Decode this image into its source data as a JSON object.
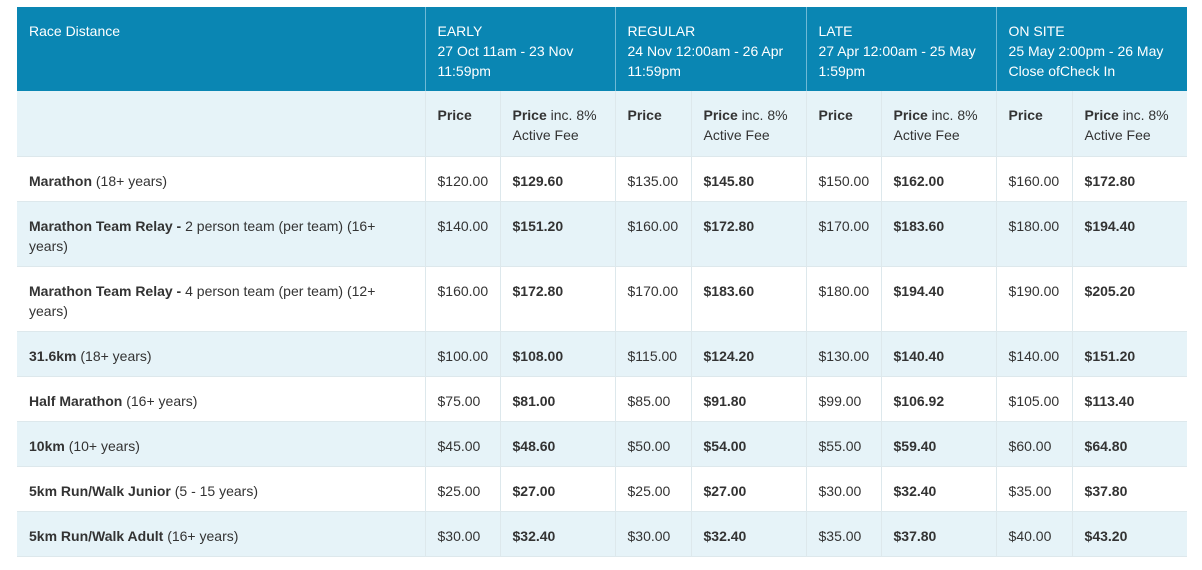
{
  "table": {
    "distance_header": "Race Distance",
    "periods": [
      {
        "name": "EARLY",
        "range": "27 Oct  11am - 23 Nov 11:59pm"
      },
      {
        "name": "REGULAR",
        "range": "24 Nov 12:00am - 26 Apr 11:59pm"
      },
      {
        "name": "LATE",
        "range": "27 Apr 12:00am - 25 May 1:59pm"
      },
      {
        "name": "ON SITE",
        "range": "25 May 2:00pm - 26 May Close ofCheck In"
      }
    ],
    "sub_headers": {
      "price": "Price",
      "price_fee_bold": "Price",
      "price_fee_rest": " inc. 8% Active Fee"
    },
    "rows": [
      {
        "name": "Marathon",
        "detail": " (18+ years)",
        "prices": [
          "$120.00",
          "$129.60",
          "$135.00",
          "$145.80",
          "$150.00",
          "$162.00",
          "$160.00",
          "$172.80"
        ]
      },
      {
        "name": "Marathon Team Relay - ",
        "detail": "2 person team (per team) (16+ years)",
        "prices": [
          "$140.00",
          "$151.20",
          "$160.00",
          "$172.80",
          "$170.00",
          "$183.60",
          "$180.00",
          "$194.40"
        ]
      },
      {
        "name": "Marathon Team Relay - ",
        "detail": "4 person team (per team) (12+ years)",
        "prices": [
          "$160.00",
          "$172.80",
          "$170.00",
          "$183.60",
          "$180.00",
          "$194.40",
          "$190.00",
          "$205.20"
        ]
      },
      {
        "name": "31.6km",
        "detail": " (18+ years)",
        "prices": [
          "$100.00",
          "$108.00",
          "$115.00",
          "$124.20",
          "$130.00",
          "$140.40",
          "$140.00",
          "$151.20"
        ]
      },
      {
        "name": "Half Marathon",
        "detail": " (16+ years)",
        "prices": [
          "$75.00",
          "$81.00",
          "$85.00",
          "$91.80",
          "$99.00",
          "$106.92",
          "$105.00",
          "$113.40"
        ]
      },
      {
        "name": "10km",
        "detail": " (10+ years)",
        "prices": [
          "$45.00",
          "$48.60",
          "$50.00",
          "$54.00",
          "$55.00",
          "$59.40",
          "$60.00",
          "$64.80"
        ]
      },
      {
        "name": "5km Run/Walk Junior",
        "detail": " (5 - 15 years)",
        "prices": [
          "$25.00",
          "$27.00",
          "$25.00",
          "$27.00",
          "$30.00",
          "$32.40",
          "$35.00",
          "$37.80"
        ]
      },
      {
        "name": "5km Run/Walk  Adult",
        "detail": " (16+ years)",
        "prices": [
          "$30.00",
          "$32.40",
          "$30.00",
          "$32.40",
          "$35.00",
          "$37.80",
          "$40.00",
          "$43.20"
        ]
      }
    ]
  }
}
